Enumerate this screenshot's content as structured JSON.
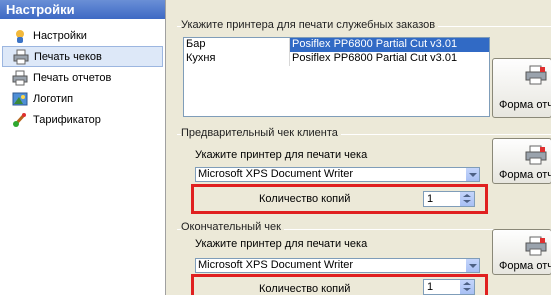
{
  "sidebar": {
    "title": "Настройки",
    "items": [
      {
        "label": "Настройки",
        "icon": "settings-icon"
      },
      {
        "label": "Печать чеков",
        "icon": "printer-icon"
      },
      {
        "label": "Печать отчетов",
        "icon": "printer-icon"
      },
      {
        "label": "Логотип",
        "icon": "logo-icon"
      },
      {
        "label": "Тарификатор",
        "icon": "brush-icon"
      }
    ]
  },
  "service_orders": {
    "title": "Укажите принтера для печати служебных заказов",
    "rows": [
      {
        "name": "Бар",
        "printer": "Posiflex PP6800 Partial Cut v3.01"
      },
      {
        "name": "Кухня",
        "printer": "Posiflex PP6800 Partial Cut v3.01"
      }
    ],
    "button_label": "Форма отчета"
  },
  "pre_check": {
    "title": "Предварительный чек клиента",
    "caption": "Укажите принтер для печати чека",
    "printer": "Microsoft XPS Document Writer",
    "copies_label": "Количество копий",
    "copies": "1",
    "button_label": "Форма отчета"
  },
  "final_check": {
    "title": "Окончательный чек",
    "caption": "Укажите принтер для печати чека",
    "printer": "Microsoft XPS Document Writer",
    "copies_label": "Количество копий",
    "copies": "1",
    "button_label": "Форма отчета"
  }
}
